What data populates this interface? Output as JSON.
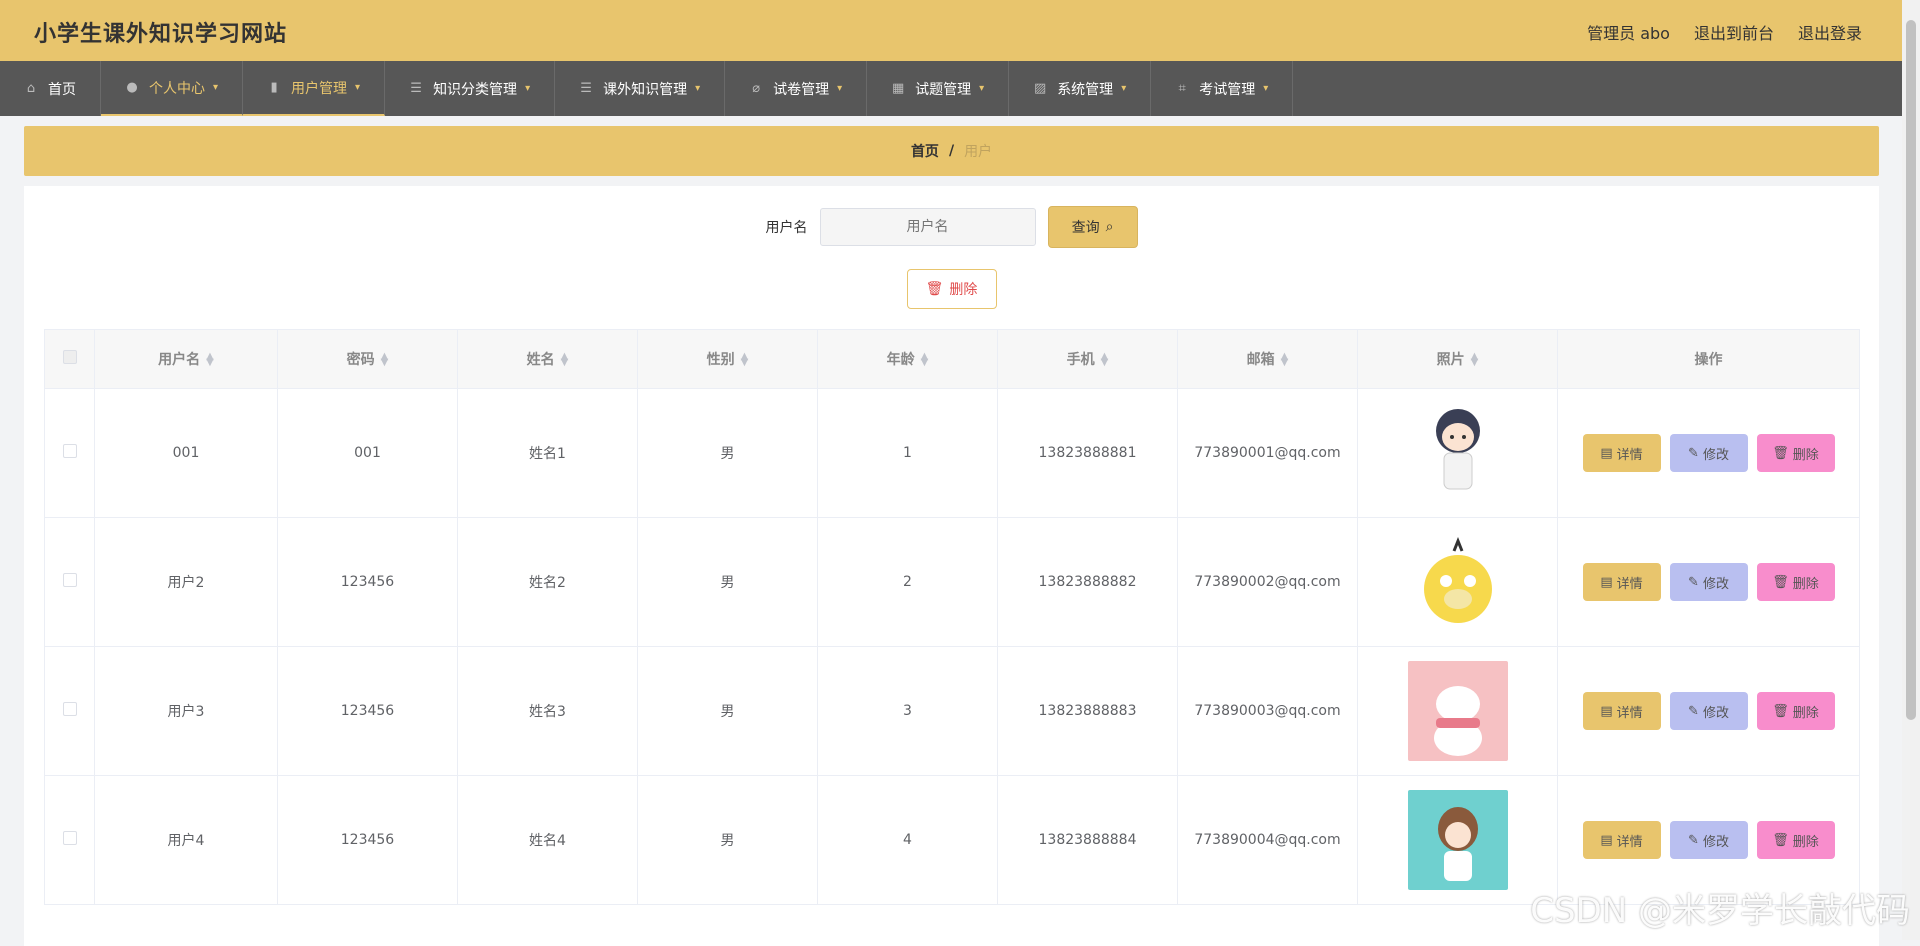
{
  "header": {
    "site_title": "小学生课外知识学习网站",
    "admin_label": "管理员 abo",
    "back_front": "退出到前台",
    "logout": "退出登录"
  },
  "nav": [
    {
      "label": "首页",
      "icon": "home-icon"
    },
    {
      "label": "个人中心",
      "icon": "user-icon"
    },
    {
      "label": "用户管理",
      "icon": "book-icon"
    },
    {
      "label": "知识分类管理",
      "icon": "list-icon"
    },
    {
      "label": "课外知识管理",
      "icon": "list-icon"
    },
    {
      "label": "试卷管理",
      "icon": "bell-off-icon"
    },
    {
      "label": "试题管理",
      "icon": "grid-icon"
    },
    {
      "label": "系统管理",
      "icon": "chart-icon"
    },
    {
      "label": "考试管理",
      "icon": "crop-icon"
    }
  ],
  "breadcrumb": {
    "home": "首页",
    "sep": "/",
    "current": "用户"
  },
  "search": {
    "label": "用户名",
    "placeholder": "用户名",
    "button": "查询"
  },
  "delete_button": "删除",
  "table": {
    "headers": [
      "用户名",
      "密码",
      "姓名",
      "性别",
      "年龄",
      "手机",
      "邮箱",
      "照片",
      "操作"
    ],
    "rows": [
      {
        "username": "001",
        "password": "001",
        "name": "姓名1",
        "gender": "男",
        "age": "1",
        "phone": "13823888881",
        "email": "773890001@qq.com"
      },
      {
        "username": "用户2",
        "password": "123456",
        "name": "姓名2",
        "gender": "男",
        "age": "2",
        "phone": "13823888882",
        "email": "773890002@qq.com"
      },
      {
        "username": "用户3",
        "password": "123456",
        "name": "姓名3",
        "gender": "男",
        "age": "3",
        "phone": "13823888883",
        "email": "773890003@qq.com"
      },
      {
        "username": "用户4",
        "password": "123456",
        "name": "姓名4",
        "gender": "男",
        "age": "4",
        "phone": "13823888884",
        "email": "773890004@qq.com"
      }
    ],
    "actions": {
      "detail": "详情",
      "edit": "修改",
      "remove": "删除"
    }
  },
  "watermark": "CSDN @米罗学长敲代码",
  "colors": {
    "accent": "#e8c56d",
    "nav_bg": "#575757",
    "edit": "#b9bff0",
    "remove": "#f88dcc"
  }
}
